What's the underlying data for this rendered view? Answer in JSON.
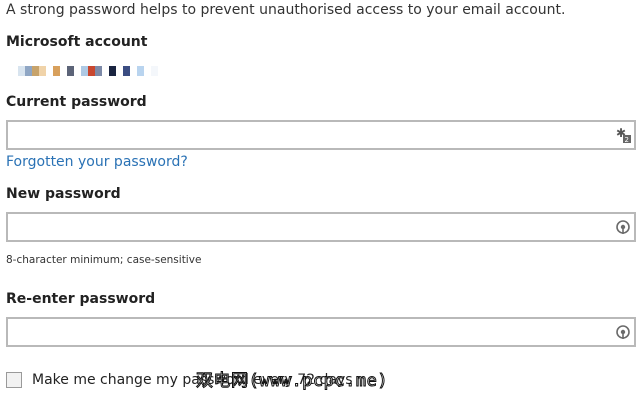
{
  "intro_text": "A strong password helps to prevent unauthorised access to your email account.",
  "account": {
    "label": "Microsoft account",
    "pixel_colors": [
      "#d8e4ef",
      "#8fa6c4",
      "#c7a36b",
      "#f0d3a9",
      "#ffffff",
      "#d8a05c",
      "#ffffff",
      "#5c6478",
      "#ffffff",
      "#aec9e4",
      "#c8472f",
      "#7d8aa8",
      "#ffffff",
      "#1a2440",
      "#ffffff",
      "#3b4d82",
      "#ffffff",
      "#b9d4ef",
      "#ffffff",
      "#f4f7fb"
    ]
  },
  "current_password": {
    "label": "Current password",
    "value": "",
    "icon": "keyboard-icon"
  },
  "forgot_link": "Forgotten your password?",
  "new_password": {
    "label": "New password",
    "value": "",
    "hint": "8-character minimum; case-sensitive",
    "icon": "password-reveal-icon"
  },
  "reenter_password": {
    "label": "Re-enter password",
    "value": "",
    "icon": "password-reveal-icon"
  },
  "change_periodically": {
    "label": "Make me change my password every 72 days",
    "checked": false
  },
  "watermark": "双电网(www.pcpc.me)",
  "colors": {
    "link": "#2a72b5",
    "field_border": "#b9b9b9"
  }
}
